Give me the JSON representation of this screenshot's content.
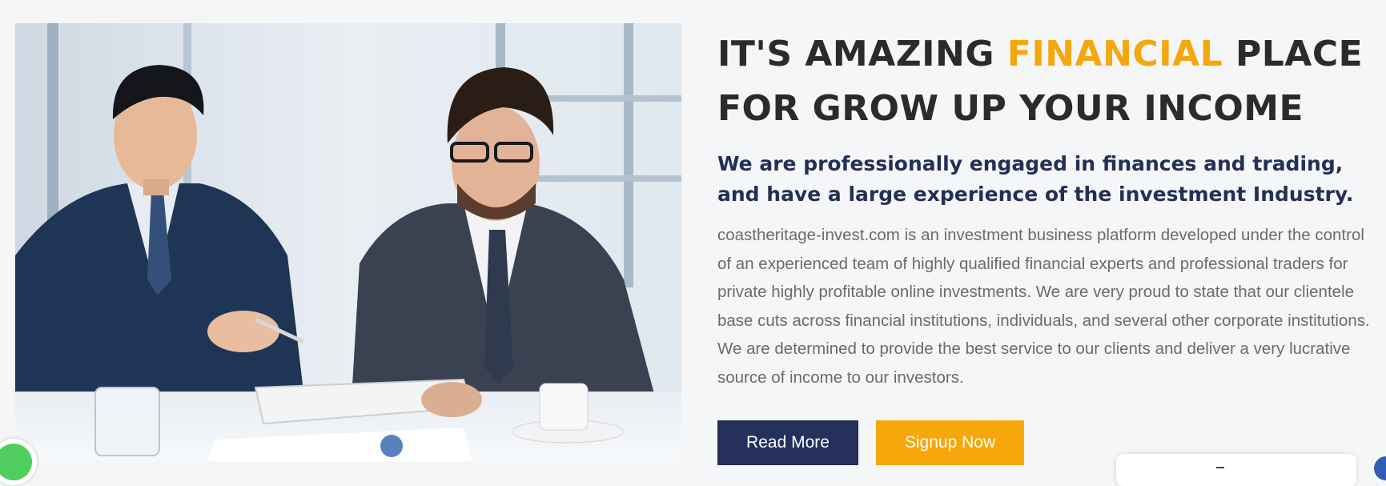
{
  "hero": {
    "headline_prefix": "IT'S AMAZING ",
    "headline_accent": "FINANCIAL",
    "headline_suffix_line1": " PLACE",
    "headline_line2": "FOR GROW UP YOUR INCOME",
    "subheading": "We are professionally engaged in finances and trading, and have a large experience of the investment Industry.",
    "description": "coastheritage-invest.com is an investment business platform developed under the control of an experienced team of highly qualified financial experts and professional traders for private highly profitable online investments. We are very proud to state that our clientele base cuts across financial institutions, individuals, and several other corporate institutions. We are determined to provide the best service to our clients and deliver a very lucrative source of income to our investors."
  },
  "buttons": {
    "read_more": "Read More",
    "signup_now": "Signup Now"
  },
  "image": {
    "semantic": "business-meeting-photo"
  },
  "widgets": {
    "chat_icon": "whatsapp-icon",
    "edge_icon": "support-icon"
  },
  "colors": {
    "accent": "#f6a70b",
    "navy": "#25305b",
    "heading": "#2b2b2b",
    "subheading": "#242f56",
    "body": "#6b6b6b",
    "background": "#f5f6f8"
  }
}
